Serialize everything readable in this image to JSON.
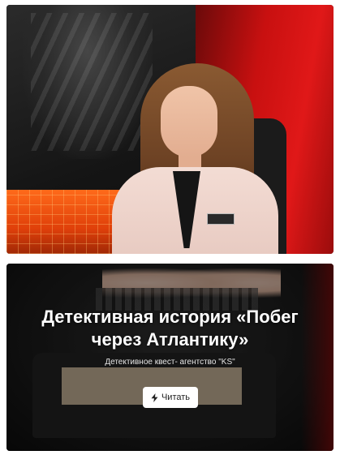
{
  "article": {
    "title": "Детективная история «Побег через Атлантику»",
    "subtitle": "Детективное квест- агентство \"KS\"",
    "read_button": {
      "label": "Читать",
      "icon": "lightning-icon"
    }
  },
  "colors": {
    "button_bg": "#ffffff",
    "title_text": "#ffffff",
    "accent_red": "#c81010"
  }
}
